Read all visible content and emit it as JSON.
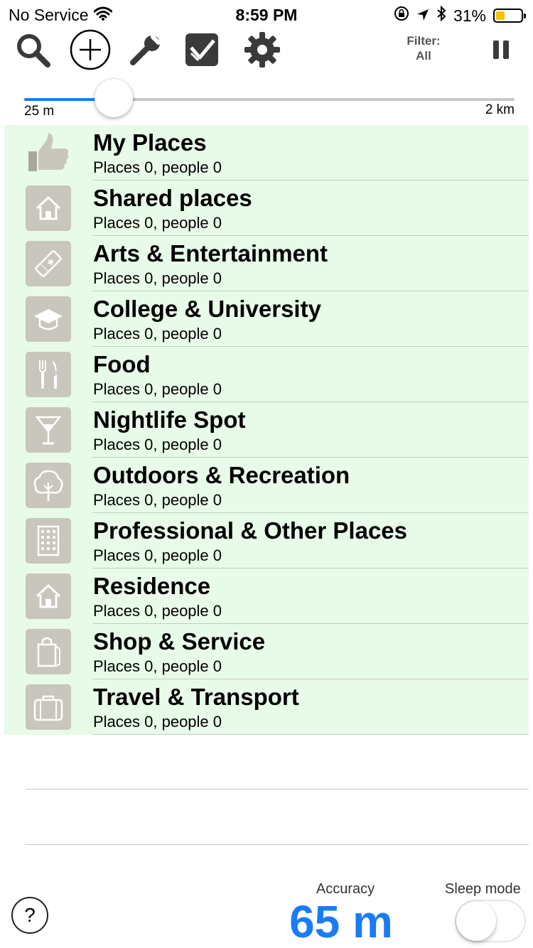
{
  "status_bar": {
    "carrier": "No Service",
    "time": "8:59 PM",
    "battery_percent": "31%",
    "icons": [
      "wifi-icon",
      "orientation-lock-icon",
      "location-arrow-icon",
      "bluetooth-icon",
      "battery-icon"
    ]
  },
  "toolbar": {
    "icons": [
      "search-icon",
      "add-icon",
      "wrench-icon",
      "checkin-icon",
      "settings-icon",
      "pause-icon"
    ],
    "filter_label": "Filter:",
    "filter_value": "All"
  },
  "radius_slider": {
    "min_label": "25 m",
    "max_label": "2 km",
    "position_fraction": 0.23
  },
  "categories": [
    {
      "title": "My Places",
      "subtitle": "Places 0, people 0",
      "icon": "thumbs-up-icon"
    },
    {
      "title": "Shared places",
      "subtitle": "Places 0, people 0",
      "icon": "house-icon"
    },
    {
      "title": "Arts & Entertainment",
      "subtitle": "Places 0, people 0",
      "icon": "ticket-icon"
    },
    {
      "title": "College & University",
      "subtitle": "Places 0, people 0",
      "icon": "graduation-cap-icon"
    },
    {
      "title": "Food",
      "subtitle": "Places 0, people 0",
      "icon": "fork-knife-icon"
    },
    {
      "title": "Nightlife Spot",
      "subtitle": "Places 0, people 0",
      "icon": "cocktail-glass-icon"
    },
    {
      "title": "Outdoors & Recreation",
      "subtitle": "Places 0, people 0",
      "icon": "tree-icon"
    },
    {
      "title": "Professional & Other Places",
      "subtitle": "Places 0, people 0",
      "icon": "office-building-icon"
    },
    {
      "title": "Residence",
      "subtitle": "Places 0, people 0",
      "icon": "house-icon"
    },
    {
      "title": "Shop & Service",
      "subtitle": "Places 0, people 0",
      "icon": "shopping-bag-icon"
    },
    {
      "title": "Travel & Transport",
      "subtitle": "Places 0, people 0",
      "icon": "suitcase-icon"
    }
  ],
  "footer": {
    "help_glyph": "?",
    "accuracy_label": "Accuracy",
    "accuracy_value": "65 m",
    "sleep_label": "Sleep mode",
    "sleep_on": false
  },
  "colors": {
    "accent": "#1a7cf5",
    "row_background": "#e8fbe8",
    "icon_tile": "#c8c6bd",
    "battery_fill": "#f5c400"
  }
}
